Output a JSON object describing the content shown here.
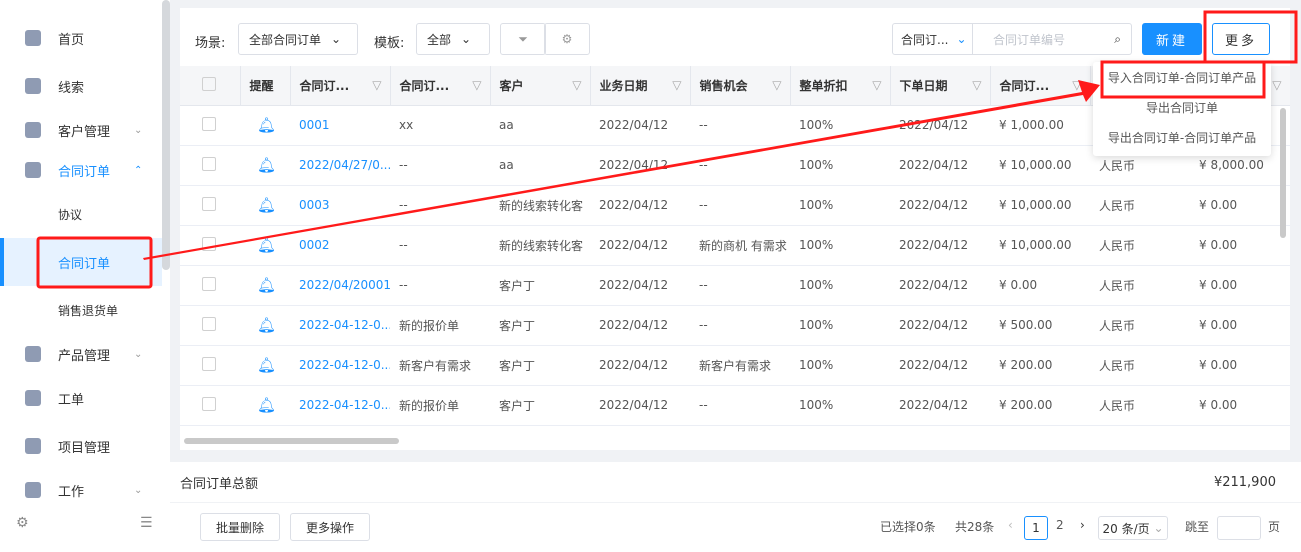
{
  "sidebar": {
    "items": [
      {
        "label": "首页",
        "icon": "home-icon"
      },
      {
        "label": "线索",
        "icon": "leads-icon"
      },
      {
        "label": "客户管理",
        "icon": "user-icon",
        "chevron": "⌄"
      },
      {
        "label": "合同订单",
        "icon": "contract-icon",
        "chevron": "⌃"
      },
      {
        "label": "协议"
      },
      {
        "label": "合同订单"
      },
      {
        "label": "销售退货单"
      },
      {
        "label": "产品管理",
        "icon": "box-icon",
        "chevron": "⌄"
      },
      {
        "label": "工单",
        "icon": "clipboard-icon"
      },
      {
        "label": "项目管理",
        "icon": "folder-icon"
      },
      {
        "label": "工作",
        "icon": "id-card-icon",
        "chevron": "⌄"
      }
    ]
  },
  "toolbar": {
    "scene_label": "场景:",
    "scene_value": "全部合同订单",
    "template_label": "模板:",
    "template_value": "全部",
    "search_field": "合同订...",
    "search_placeholder": "合同订单编号",
    "new_label": "新建",
    "more_label": "更多"
  },
  "more_menu": [
    "导入合同订单-合同订单产品",
    "导出合同订单",
    "导出合同订单-合同订单产品"
  ],
  "table": {
    "headers": [
      "",
      "提醒",
      "合同订...",
      "合同订...",
      "客户",
      "业务日期",
      "销售机会",
      "整单折扣",
      "下单日期",
      "合同订...",
      "",
      ""
    ],
    "rows": [
      [
        "0001",
        "xx",
        "aa",
        "2022/04/12",
        "--",
        "100%",
        "2022/04/12",
        "¥ 1,000.00",
        "",
        ""
      ],
      [
        "2022/04/27/0...",
        "--",
        "aa",
        "2022/04/12",
        "--",
        "100%",
        "2022/04/12",
        "¥ 10,000.00",
        "人民币",
        "¥ 8,000.00"
      ],
      [
        "0003",
        "--",
        "新的线索转化客",
        "2022/04/12",
        "--",
        "100%",
        "2022/04/12",
        "¥ 10,000.00",
        "人民币",
        "¥ 0.00"
      ],
      [
        "0002",
        "--",
        "新的线索转化客",
        "2022/04/12",
        "新的商机 有需求",
        "100%",
        "2022/04/12",
        "¥ 10,000.00",
        "人民币",
        "¥ 0.00"
      ],
      [
        "2022/04/20001",
        "--",
        "客户丁",
        "2022/04/12",
        "--",
        "100%",
        "2022/04/12",
        "¥ 0.00",
        "人民币",
        "¥ 0.00"
      ],
      [
        "2022-04-12-0...",
        "新的报价单",
        "客户丁",
        "2022/04/12",
        "--",
        "100%",
        "2022/04/12",
        "¥ 500.00",
        "人民币",
        "¥ 0.00"
      ],
      [
        "2022-04-12-0...",
        "新客户有需求",
        "客户丁",
        "2022/04/12",
        "新客户有需求",
        "100%",
        "2022/04/12",
        "¥ 200.00",
        "人民币",
        "¥ 0.00"
      ],
      [
        "2022-04-12-0...",
        "新的报价单",
        "客户丁",
        "2022/04/12",
        "--",
        "100%",
        "2022/04/12",
        "¥ 200.00",
        "人民币",
        "¥ 0.00"
      ]
    ]
  },
  "summary": {
    "label": "合同订单总额",
    "value": "¥211,900"
  },
  "footer": {
    "batch_delete": "批量删除",
    "more_actions": "更多操作",
    "selected": "已选择0条",
    "total": "共28条",
    "current_page": "1",
    "page2": "2",
    "page_size": "20 条/页",
    "jump_label": "跳至",
    "page_suffix": "页"
  },
  "colors": {
    "accent": "#1890ff",
    "annotation": "#ff1a1a"
  }
}
